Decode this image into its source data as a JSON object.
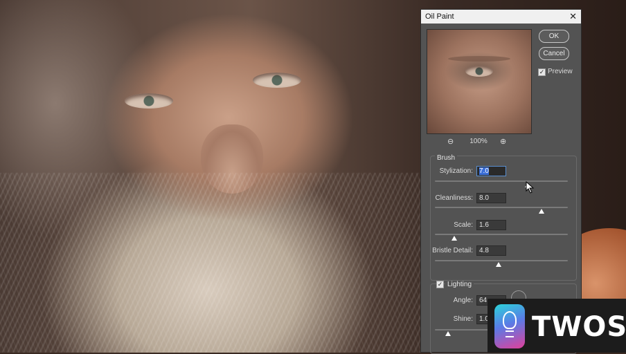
{
  "dialog": {
    "title": "Oil Paint",
    "close_icon": "close-icon",
    "ok_label": "OK",
    "cancel_label": "Cancel",
    "preview_label": "Preview",
    "preview_checked": true,
    "zoom_out_icon": "zoom-out-icon",
    "zoom_in_icon": "zoom-in-icon",
    "zoom_level": "100%"
  },
  "brush": {
    "title": "Brush",
    "stylization": {
      "label": "Stylization:",
      "value": "7.0",
      "level": 0.7
    },
    "cleanliness": {
      "label": "Cleanliness:",
      "value": "8.0",
      "level": 0.8
    },
    "scale": {
      "label": "Scale:",
      "value": "1.6",
      "level": 0.14
    },
    "bristle_detail": {
      "label": "Bristle Detail:",
      "value": "4.8",
      "level": 0.48
    }
  },
  "lighting": {
    "title": "Lighting",
    "enabled": true,
    "angle": {
      "label": "Angle:",
      "value": "64"
    },
    "shine": {
      "label": "Shine:",
      "value": "1.0",
      "level": 0.1
    }
  },
  "watermark": {
    "text": "TWOS",
    "icon": "lightbulb-icon"
  },
  "colors": {
    "dialog_bg": "#535353",
    "titlebar_bg": "#f0f0f0",
    "highlight": "#3b6fd8"
  }
}
